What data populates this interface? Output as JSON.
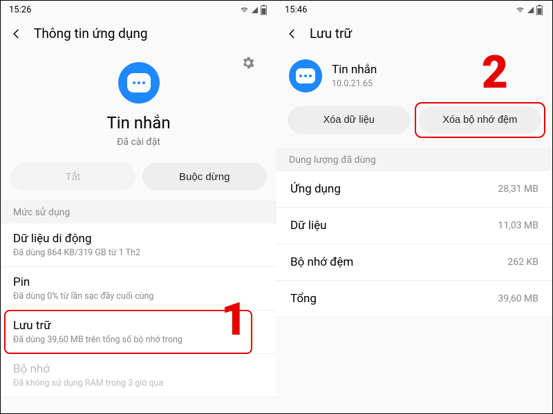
{
  "left": {
    "status": {
      "time": "15:26"
    },
    "header": {
      "title": "Thông tin ứng dụng"
    },
    "app": {
      "name": "Tin nhắn",
      "status": "Đã cài đặt"
    },
    "buttons": {
      "disable": "Tắt",
      "force_stop": "Buộc dừng"
    },
    "usage_label": "Mức sử dụng",
    "rows": {
      "mobile_data": {
        "title": "Dữ liệu di động",
        "sub": "Đã dùng 864 KB/319 GB từ 1 Th2"
      },
      "battery": {
        "title": "Pin",
        "sub": "Đã dùng 0% từ lần sạc đầy cuối cùng"
      },
      "storage": {
        "title": "Lưu trữ",
        "sub": "Đã dùng 39,60 MB trên tổng số bộ nhớ trong"
      },
      "memory": {
        "title": "Bộ nhớ",
        "sub": "Đã không sử dụng RAM trong 3 giờ qua"
      }
    },
    "callout": "1"
  },
  "right": {
    "status": {
      "time": "15:46"
    },
    "header": {
      "title": "Lưu trữ"
    },
    "app": {
      "name": "Tin nhắn",
      "version": "10.0.21.65"
    },
    "buttons": {
      "clear_data": "Xóa dữ liệu",
      "clear_cache": "Xóa bộ nhớ đệm"
    },
    "usage_label": "Dung lượng đã dùng",
    "rows": {
      "app": {
        "label": "Ứng dụng",
        "value": "28,31 MB"
      },
      "data": {
        "label": "Dữ liệu",
        "value": "11,03 MB"
      },
      "cache": {
        "label": "Bộ nhớ đệm",
        "value": "262 KB"
      },
      "total": {
        "label": "Tổng",
        "value": "39,60 MB"
      }
    },
    "callout": "2"
  }
}
